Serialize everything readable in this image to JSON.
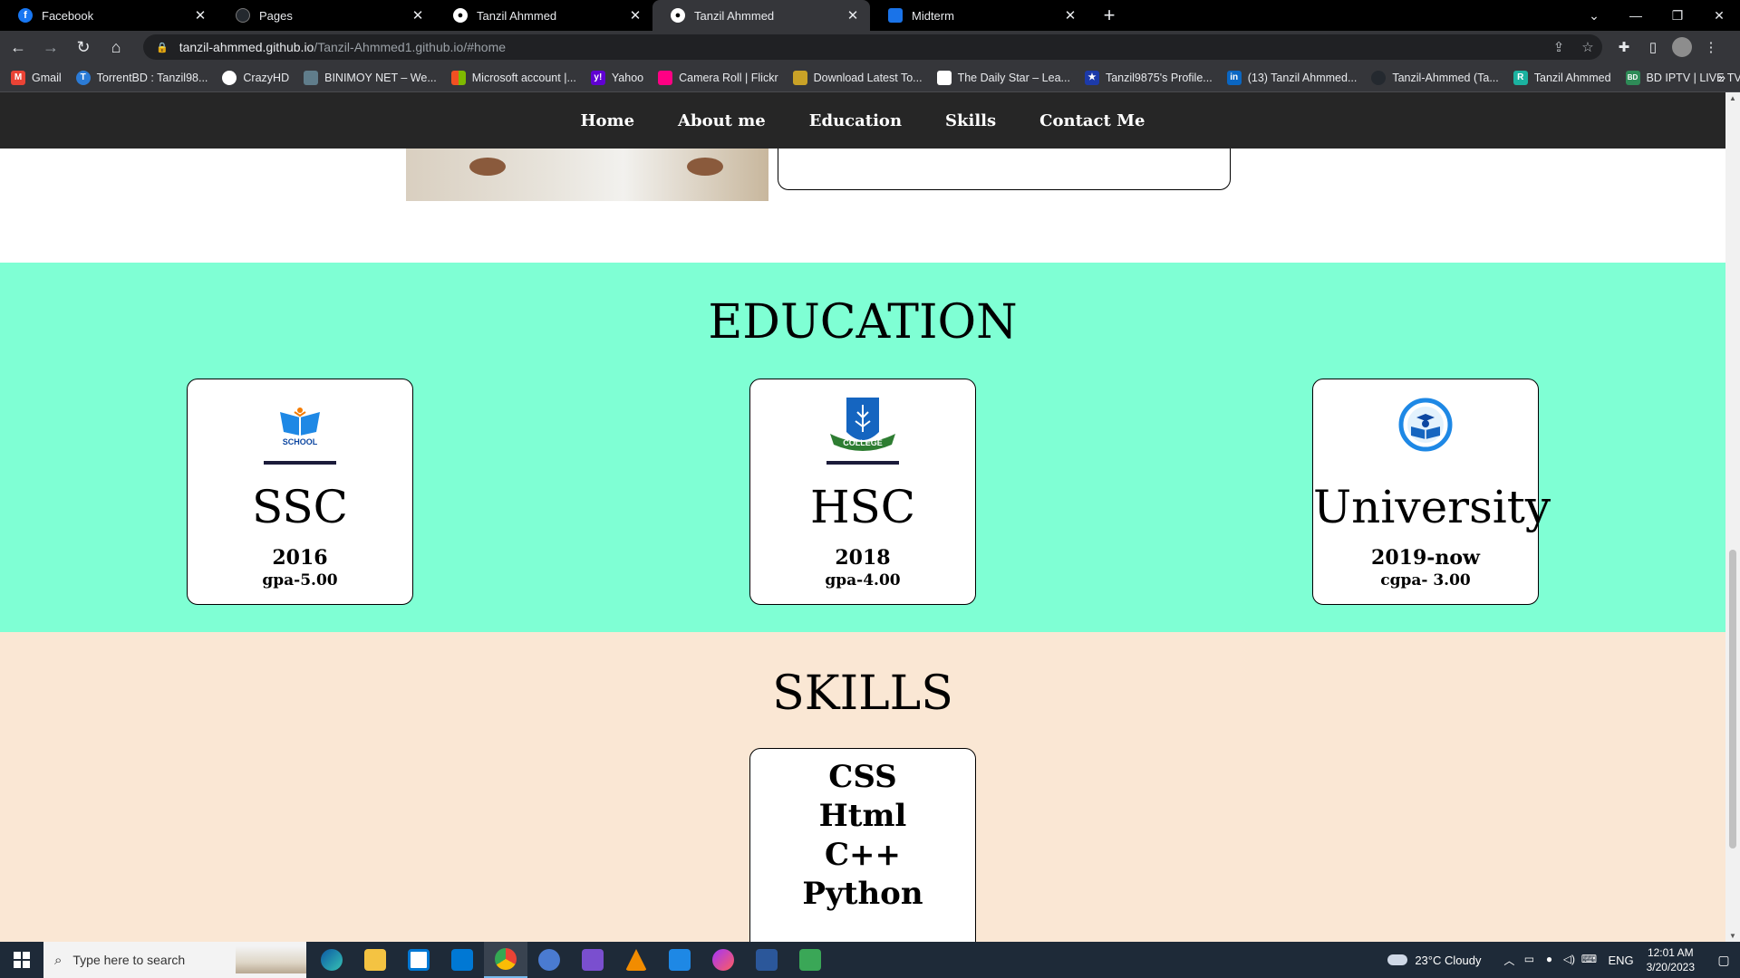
{
  "browser": {
    "tabs": [
      {
        "title": "Facebook",
        "color": "#1877f2",
        "glyph": "f",
        "active": false
      },
      {
        "title": "Pages",
        "color": "#24292f",
        "glyph": "",
        "active": false
      },
      {
        "title": "Tanzil Ahmmed",
        "color": "#3c4043",
        "glyph": "",
        "active": false
      },
      {
        "title": "Tanzil Ahmmed",
        "color": "#3c4043",
        "glyph": "",
        "active": true
      },
      {
        "title": "Midterm",
        "color": "#1a73e8",
        "glyph": "",
        "active": false
      }
    ],
    "url_host": "tanzil-ahmmed.github.io",
    "url_path": "/Tanzil-Ahmmed1.github.io/#home",
    "bookmarks": [
      {
        "label": "Gmail",
        "color": "#ea4335",
        "glyph": "M"
      },
      {
        "label": "TorrentBD : Tanzil98...",
        "color": "#2b7bd6",
        "glyph": "T"
      },
      {
        "label": "CrazyHD",
        "color": "#5f6368",
        "glyph": ""
      },
      {
        "label": "BINIMOY NET – We...",
        "color": "#607d8b",
        "glyph": ""
      },
      {
        "label": "Microsoft account |...",
        "color": "#f25022",
        "glyph": ""
      },
      {
        "label": "Yahoo",
        "color": "#6001d2",
        "glyph": "y!"
      },
      {
        "label": "Camera Roll | Flickr",
        "color": "#ff0084",
        "glyph": ""
      },
      {
        "label": "Download Latest To...",
        "color": "#c9a227",
        "glyph": ""
      },
      {
        "label": "The Daily Star – Lea...",
        "color": "#ffffff",
        "glyph": ""
      },
      {
        "label": "Tanzil9875's Profile...",
        "color": "#1c3aa9",
        "glyph": "★"
      },
      {
        "label": "(13) Tanzil Ahmmed...",
        "color": "#0a66c2",
        "glyph": "in"
      },
      {
        "label": "Tanzil-Ahmmed (Ta...",
        "color": "#24292f",
        "glyph": ""
      },
      {
        "label": "Tanzil Ahmmed",
        "color": "#1bb2a0",
        "glyph": "R"
      },
      {
        "label": "BD IPTV | LIVE TV",
        "color": "#2e8b57",
        "glyph": "BD"
      }
    ]
  },
  "site": {
    "nav": [
      "Home",
      "About me",
      "Education",
      "Skills",
      "Contact Me"
    ],
    "education": {
      "title": "EDUCATION",
      "cards": [
        {
          "name": "SSC",
          "year": "2016",
          "gpa": "gpa-5.00",
          "logo": "school-logo",
          "logo_text": "SCHOOL"
        },
        {
          "name": "HSC",
          "year": "2018",
          "gpa": "gpa-4.00",
          "logo": "college-logo",
          "logo_text": "COLLEGE"
        },
        {
          "name": "University",
          "year": "2019-now",
          "gpa": "cgpa- 3.00",
          "logo": "university-logo",
          "logo_text": ""
        }
      ]
    },
    "skills": {
      "title": "SKILLS",
      "items": [
        "CSS",
        "Html",
        "C++",
        "Python"
      ]
    },
    "colors": {
      "education_bg": "#7fffd4",
      "skills_bg": "#fae7d4",
      "nav_bg": "#262626"
    }
  },
  "taskbar": {
    "search_placeholder": "Type here to search",
    "weather": "23°C  Cloudy",
    "language": "ENG",
    "time": "12:01 AM",
    "date": "3/20/2023"
  }
}
